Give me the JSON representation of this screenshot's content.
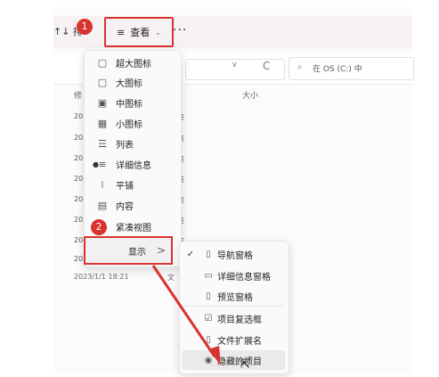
{
  "toolbar": {
    "sort_label": "↑↓ 排",
    "view_label": "查看",
    "more_label": "···"
  },
  "badges": {
    "step1": "1",
    "step2": "2"
  },
  "address": {
    "chevron": "∨",
    "refresh": "C",
    "search_icon": "⌕",
    "search_placeholder": "在 OS (C:) 中"
  },
  "columns": {
    "date": "修",
    "size": "大小"
  },
  "file_rows": {
    "date_fragments": [
      "20",
      "20",
      "20",
      "20",
      "20",
      "20",
      "20",
      "20"
    ],
    "type_fragments": [
      "夹",
      "夹",
      "夹",
      "夹",
      "夹",
      "夹",
      "夹"
    ],
    "last_date": "2023/1/1 18:21",
    "last_type": "文"
  },
  "view_menu": {
    "items": [
      {
        "label": "超大图标",
        "icon": "monitor-icon"
      },
      {
        "label": "大图标",
        "icon": "monitor-icon"
      },
      {
        "label": "中图标",
        "icon": "grid-icon"
      },
      {
        "label": "小图标",
        "icon": "small-grid-icon"
      },
      {
        "label": "列表",
        "icon": "list-icon"
      },
      {
        "label": "详细信息",
        "icon": "details-icon",
        "selected": true
      },
      {
        "label": "平铺",
        "icon": "tiles-icon"
      },
      {
        "label": "内容",
        "icon": "content-icon"
      },
      {
        "label": "紧凑视图",
        "icon": "compact-icon"
      }
    ],
    "show_label": "显示",
    "show_arrow": ">"
  },
  "show_submenu": {
    "items": [
      {
        "label": "导航窗格",
        "icon": "nav-pane-icon",
        "checked": true
      },
      {
        "label": "详细信息窗格",
        "icon": "details-pane-icon"
      },
      {
        "label": "预览窗格",
        "icon": "preview-pane-icon"
      },
      {
        "label": "项目复选框",
        "icon": "checkbox-icon"
      },
      {
        "label": "文件扩展名",
        "icon": "file-icon"
      },
      {
        "label": "隐藏的项目",
        "icon": "eye-icon",
        "hovered": true
      }
    ],
    "check_mark": "✓"
  },
  "colors": {
    "accent_red": "#d9332f",
    "toolbar_bg": "#f6f1f2"
  }
}
